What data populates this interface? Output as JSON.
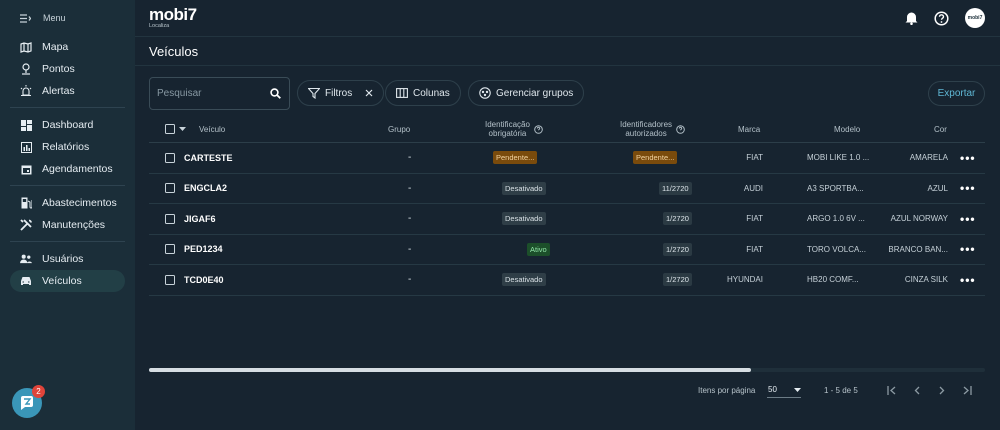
{
  "sidebar": {
    "menu_label": "Menu",
    "items": [
      {
        "label": "Mapa",
        "icon": "map-icon"
      },
      {
        "label": "Pontos",
        "icon": "pin-icon"
      },
      {
        "label": "Alertas",
        "icon": "alert-icon"
      },
      {
        "label": "Dashboard",
        "icon": "dashboard-icon"
      },
      {
        "label": "Relatórios",
        "icon": "reports-icon"
      },
      {
        "label": "Agendamentos",
        "icon": "calendar-icon"
      },
      {
        "label": "Abastecimentos",
        "icon": "fuel-icon"
      },
      {
        "label": "Manutenções",
        "icon": "tools-icon"
      },
      {
        "label": "Usuários",
        "icon": "users-icon"
      },
      {
        "label": "Veículos",
        "icon": "car-icon"
      }
    ],
    "active": "Veículos",
    "notification_count": "2"
  },
  "header": {
    "logo_text": "mobi7",
    "logo_sub": "Localiza",
    "avatar_text": "mobi7"
  },
  "page": {
    "title": "Veículos"
  },
  "toolbar": {
    "search_placeholder": "Pesquisar",
    "filters_label": "Filtros",
    "columns_label": "Colunas",
    "groups_label": "Gerenciar grupos",
    "export_label": "Exportar"
  },
  "table": {
    "headers": {
      "vehicle": "Veículo",
      "group": "Grupo",
      "mandatory_id_line1": "Identificação",
      "mandatory_id_line2": "obrigatória",
      "authorized_ids_line1": "Identificadores",
      "authorized_ids_line2": "autorizados",
      "brand": "Marca",
      "model": "Modelo",
      "color": "Cor"
    },
    "rows": [
      {
        "vehicle": "CARTESTE",
        "group": "-",
        "mandatory": "Pendente...",
        "mandatory_status": "warn",
        "authorized": "Pendente...",
        "authorized_status": "warn",
        "brand": "FIAT",
        "model": "MOBI LIKE 1.0 ...",
        "color": "AMARELA"
      },
      {
        "vehicle": "ENGCLA2",
        "group": "-",
        "mandatory": "Desativado",
        "mandatory_status": "off",
        "authorized": "11/2720",
        "authorized_status": "count",
        "brand": "AUDI",
        "model": "A3 SPORTBA...",
        "color": "AZUL"
      },
      {
        "vehicle": "JIGAF6",
        "group": "-",
        "mandatory": "Desativado",
        "mandatory_status": "off",
        "authorized": "1/2720",
        "authorized_status": "count",
        "brand": "FIAT",
        "model": "ARGO 1.0 6V ...",
        "color": "AZUL NORWAY"
      },
      {
        "vehicle": "PED1234",
        "group": "-",
        "mandatory": "Ativo",
        "mandatory_status": "on",
        "authorized": "1/2720",
        "authorized_status": "count",
        "brand": "FIAT",
        "model": "TORO VOLCA...",
        "color": "BRANCO BAN..."
      },
      {
        "vehicle": "TCD0E40",
        "group": "-",
        "mandatory": "Desativado",
        "mandatory_status": "off",
        "authorized": "1/2720",
        "authorized_status": "count",
        "brand": "HYUNDAI",
        "model": "HB20 COMF...",
        "color": "CINZA SILK"
      }
    ],
    "more_label": "•••",
    "horizontal_scroll_fraction": 0.72
  },
  "pagination": {
    "items_per_page_label": "Itens por página",
    "items_per_page_value": "50",
    "range_label": "1 - 5 de 5"
  },
  "colors": {
    "sidebar_bg": "#1b2e39",
    "main_bg": "#172430",
    "accent": "#5fb7d4",
    "active_nav": "#223f46",
    "pending": "#7a4b0c",
    "active_green": "#1c4f2a",
    "badge_red": "#e0443a"
  }
}
